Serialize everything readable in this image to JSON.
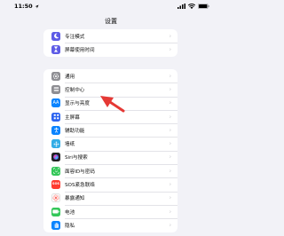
{
  "status_bar": {
    "time": "11:50",
    "location_icon": "location-arrow-icon",
    "signal_icon": "cellular-signal-icon",
    "wifi_icon": "wifi-icon",
    "battery_icon": "battery-icon"
  },
  "nav": {
    "title": "设置"
  },
  "groups": [
    {
      "rows": [
        {
          "label": "专注模式",
          "icon": "moon-icon",
          "color": "#5e5ce6"
        },
        {
          "label": "屏幕使用时间",
          "icon": "hourglass-icon",
          "color": "#5e5ce6"
        }
      ]
    },
    {
      "rows": [
        {
          "label": "通用",
          "icon": "gear-icon",
          "color": "#8e8e93"
        },
        {
          "label": "控制中心",
          "icon": "control-center-icon",
          "color": "#8e8e93"
        },
        {
          "label": "显示与亮度",
          "icon": "display-brightness-icon",
          "color": "#0a84ff",
          "glyph": "AA"
        },
        {
          "label": "主屏幕",
          "icon": "home-screen-icon",
          "color": "#2c64f0"
        },
        {
          "label": "辅助功能",
          "icon": "accessibility-icon",
          "color": "#0a84ff"
        },
        {
          "label": "墙纸",
          "icon": "wallpaper-icon",
          "color": "#32ade6"
        },
        {
          "label": "Siri与搜索",
          "icon": "siri-icon",
          "color": "#222222"
        },
        {
          "label": "面容ID与密码",
          "icon": "face-id-icon",
          "color": "#34c759"
        },
        {
          "label": "SOS紧急联络",
          "icon": "sos-icon",
          "color": "#ff3b30",
          "glyph": "SOS"
        },
        {
          "label": "暴露通知",
          "icon": "exposure-notification-icon",
          "color": "#ff3b30"
        },
        {
          "label": "电池",
          "icon": "battery-settings-icon",
          "color": "#34c759"
        },
        {
          "label": "隐私",
          "icon": "privacy-hand-icon",
          "color": "#0a84ff"
        }
      ]
    }
  ],
  "annotation": {
    "icon": "red-arrow-annotation",
    "color": "#e53935"
  }
}
